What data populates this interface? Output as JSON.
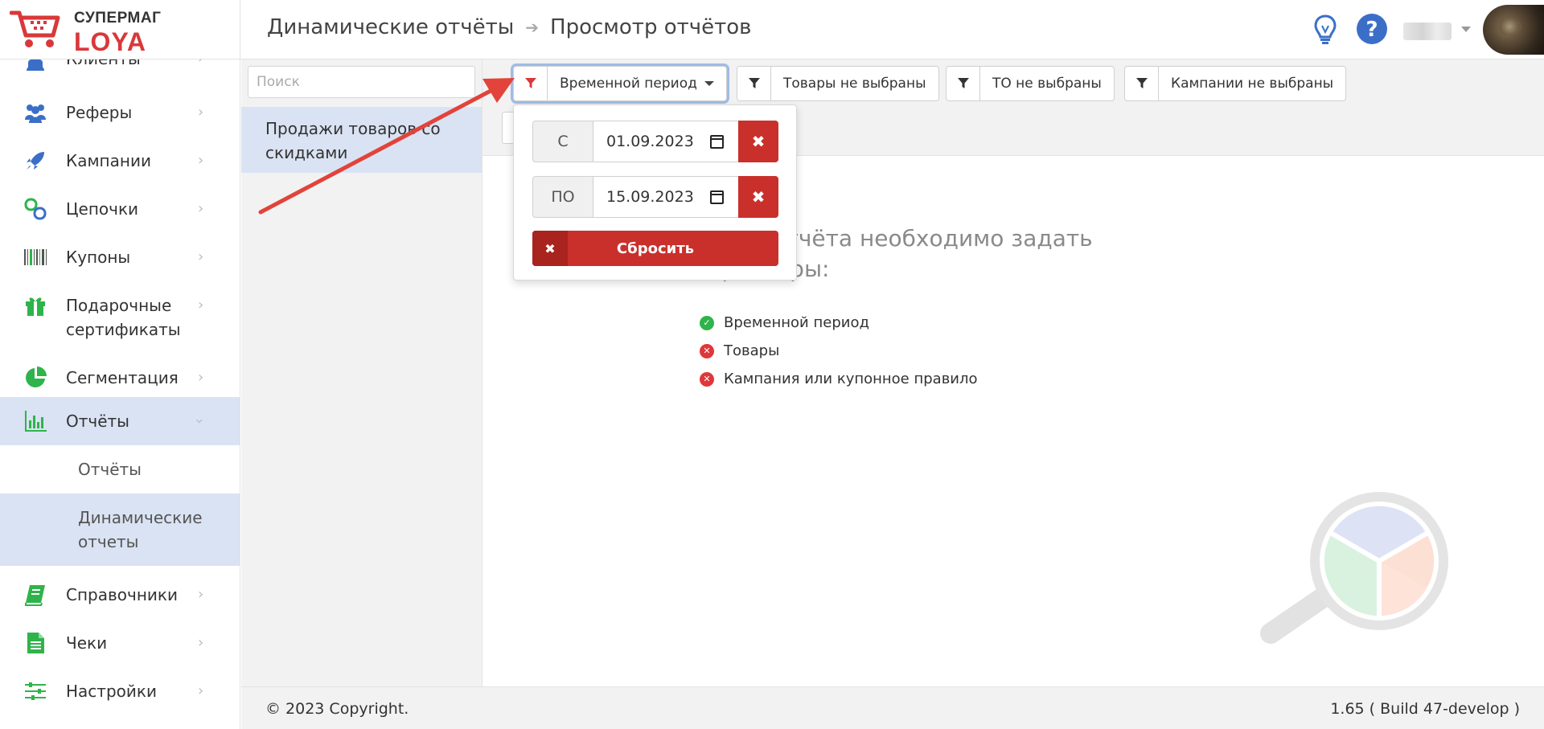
{
  "app": {
    "logo_top": "СУПЕРМАГ",
    "logo_bottom": "LOYA"
  },
  "breadcrumb": {
    "level1": "Динамические отчёты",
    "level2": "Просмотр отчётов"
  },
  "header_icons": [
    "lightbulb-icon",
    "help-icon"
  ],
  "sidebar": {
    "items": [
      {
        "label": "Клиенты",
        "icon": "user-icon"
      },
      {
        "label": "Реферы",
        "icon": "users-icon"
      },
      {
        "label": "Кампании",
        "icon": "rocket-icon"
      },
      {
        "label": "Цепочки",
        "icon": "link-icon"
      },
      {
        "label": "Купоны",
        "icon": "barcode-icon"
      },
      {
        "label": "Подарочные сертификаты",
        "icon": "gift-icon"
      },
      {
        "label": "Сегментация",
        "icon": "pie-chart-icon"
      },
      {
        "label": "Отчёты",
        "icon": "bar-chart-icon"
      },
      {
        "label": "Справочники",
        "icon": "book-icon"
      },
      {
        "label": "Чеки",
        "icon": "receipt-icon"
      },
      {
        "label": "Настройки",
        "icon": "sliders-icon"
      }
    ],
    "sub_items": [
      {
        "label": "Отчёты"
      },
      {
        "label": "Динамические отчеты"
      }
    ]
  },
  "report_list": {
    "search_placeholder": "Поиск",
    "items": [
      {
        "label": "Продажи товаров со скидками"
      }
    ]
  },
  "filters": [
    {
      "label": "Временной период",
      "icon": "filter-icon"
    },
    {
      "label": "Товары не выбраны",
      "icon": "filter-icon"
    },
    {
      "label": "ТО не выбраны",
      "icon": "filter-icon"
    },
    {
      "label": "Кампании не выбраны",
      "icon": "filter-icon"
    }
  ],
  "date_filter": {
    "from_label": "С",
    "from_value": "01.09.2023",
    "to_label": "ПО",
    "to_value": "15.09.2023",
    "reset_label": "Сбросить"
  },
  "main": {
    "message_line1": "роения отчёта необходимо задать",
    "message_line2": "ие фильтры:",
    "requirements": [
      {
        "label": "Временной период",
        "status": "ok"
      },
      {
        "label": "Товары",
        "status": "missing"
      },
      {
        "label": "Кампания или купонное правило",
        "status": "missing"
      }
    ]
  },
  "footer": {
    "copyright": "© 2023 Copyright.",
    "version": "1.65 ( Build 47-develop )"
  },
  "colors": {
    "brand_red": "#d9383a",
    "danger": "#c9302c",
    "nav_icon_blue": "#3b6fc7",
    "nav_icon_green": "#2eb44a",
    "active_bg": "#dae3f3"
  }
}
